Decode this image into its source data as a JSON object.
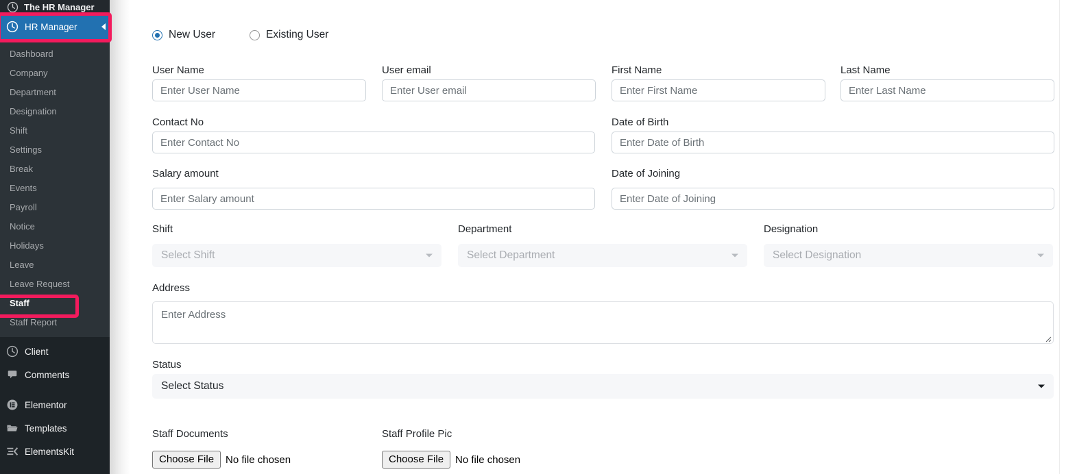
{
  "sidebar": {
    "brand": {
      "label": "The HR Manager",
      "icon": "clock-icon"
    },
    "active_menu": {
      "label": "HR Manager",
      "icon": "clock-icon",
      "color": "#2271b1"
    },
    "highlight_color": "#f31b5d",
    "submenu": [
      {
        "label": "Dashboard",
        "current": false
      },
      {
        "label": "Company",
        "current": false
      },
      {
        "label": "Department",
        "current": false
      },
      {
        "label": "Designation",
        "current": false
      },
      {
        "label": "Shift",
        "current": false
      },
      {
        "label": "Settings",
        "current": false
      },
      {
        "label": "Break",
        "current": false
      },
      {
        "label": "Events",
        "current": false
      },
      {
        "label": "Payroll",
        "current": false
      },
      {
        "label": "Notice",
        "current": false
      },
      {
        "label": "Holidays",
        "current": false
      },
      {
        "label": "Leave",
        "current": false
      },
      {
        "label": "Leave Request",
        "current": false
      },
      {
        "label": "Staff",
        "current": true
      },
      {
        "label": "Staff Report",
        "current": false
      }
    ],
    "bottom_group_a": [
      {
        "label": "Client",
        "icon": "clock-icon"
      },
      {
        "label": "Comments",
        "icon": "comment-icon"
      }
    ],
    "bottom_group_b": [
      {
        "label": "Elementor",
        "icon": "elementor-icon"
      },
      {
        "label": "Templates",
        "icon": "folder-icon"
      },
      {
        "label": "ElementsKit",
        "icon": "elementskit-icon"
      }
    ]
  },
  "form": {
    "user_type": {
      "options": [
        {
          "label": "New User",
          "selected": true
        },
        {
          "label": "Existing User",
          "selected": false
        }
      ]
    },
    "fields": {
      "user_name": {
        "label": "User Name",
        "value": "",
        "placeholder": "Enter User Name"
      },
      "user_email": {
        "label": "User email",
        "value": "",
        "placeholder": "Enter User email"
      },
      "first_name": {
        "label": "First Name",
        "value": "",
        "placeholder": "Enter First Name"
      },
      "last_name": {
        "label": "Last Name",
        "value": "",
        "placeholder": "Enter Last Name"
      },
      "contact_no": {
        "label": "Contact No",
        "value": "",
        "placeholder": "Enter Contact No"
      },
      "dob": {
        "label": "Date of Birth",
        "value": "",
        "placeholder": "Enter Date of Birth"
      },
      "salary": {
        "label": "Salary amount",
        "value": "",
        "placeholder": "Enter Salary amount"
      },
      "doj": {
        "label": "Date of Joining",
        "value": "",
        "placeholder": "Enter Date of Joining"
      },
      "address": {
        "label": "Address",
        "value": "",
        "placeholder": "Enter Address"
      }
    },
    "selects": {
      "shift": {
        "label": "Shift",
        "value": "Select Shift",
        "state": "placeholder"
      },
      "department": {
        "label": "Department",
        "value": "Select Department",
        "state": "placeholder"
      },
      "designation": {
        "label": "Designation",
        "value": "Select Designation",
        "state": "placeholder"
      },
      "status": {
        "label": "Status",
        "value": "Select Status",
        "state": "selected"
      }
    },
    "files": {
      "staff_documents": {
        "label": "Staff Documents",
        "button": "Choose File",
        "status": "No file chosen"
      },
      "staff_profile_pic": {
        "label": "Staff Profile Pic",
        "button": "Choose File",
        "status": "No file chosen"
      }
    }
  }
}
